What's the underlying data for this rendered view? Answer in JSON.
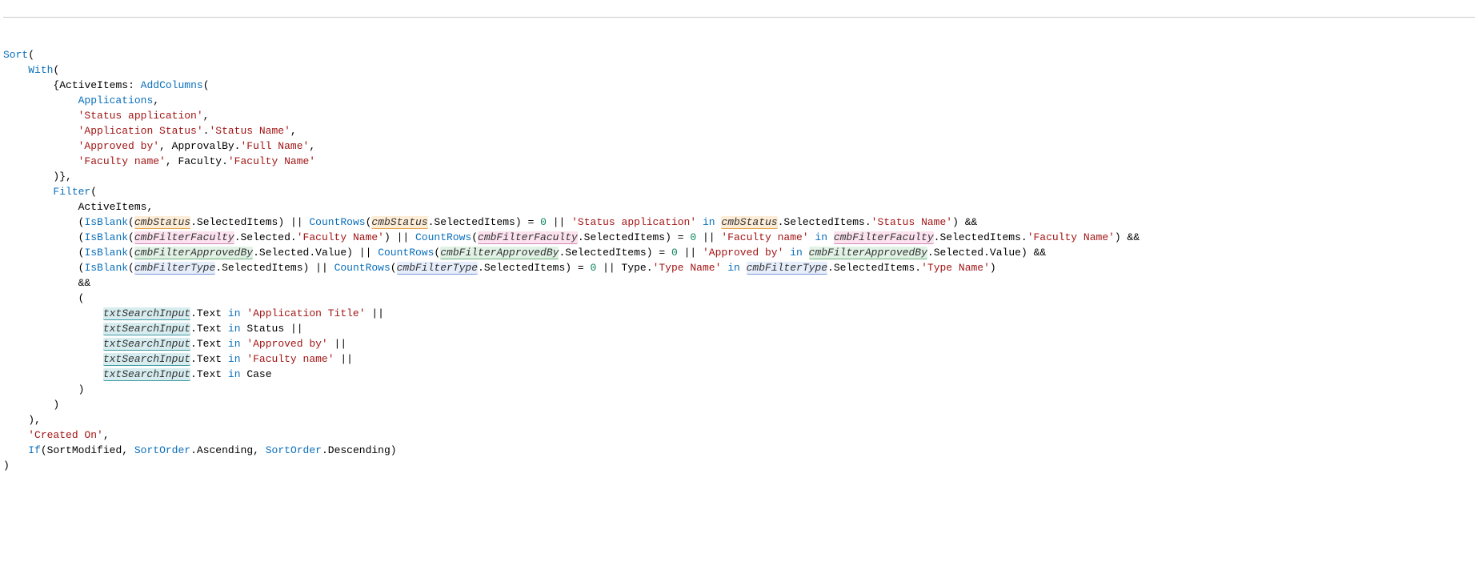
{
  "t": {
    "sort": "Sort",
    "with": "With",
    "activeItemsProp": "ActiveItems",
    "addColumns": "AddColumns",
    "applications": "Applications",
    "strStatusApplication": "'Status application'",
    "strApplicationStatus": "'Application Status'",
    "strStatusName": "'Status Name'",
    "strApprovedBy": "'Approved by'",
    "approvalBy": "ApprovalBy",
    "strFullName": "'Full Name'",
    "strFacultyNameLc": "'Faculty name'",
    "faculty": "Faculty",
    "strFacultyName": "'Faculty Name'",
    "filter": "Filter",
    "activeItems": "ActiveItems",
    "isBlank": "IsBlank",
    "cmbStatus": "cmbStatus",
    "selectedItems": "SelectedItems",
    "selected": "Selected",
    "value": "Value",
    "or": "||",
    "and": "&&",
    "countRows": "CountRows",
    "zero": "0",
    "in": "in",
    "cmbFilterFaculty": "cmbFilterFaculty",
    "cmbFilterApprovedBy": "cmbFilterApprovedBy",
    "cmbFilterType": "cmbFilterType",
    "type": "Type",
    "strTypeName": "'Type Name'",
    "txtSearchInput": "txtSearchInput",
    "text": "Text",
    "strApplicationTitle": "'Application Title'",
    "status": "Status",
    "case": "Case",
    "strCreatedOn": "'Created On'",
    "if": "If",
    "sortModified": "SortModified",
    "sortOrder": "SortOrder",
    "ascending": "Ascending",
    "descending": "Descending"
  }
}
